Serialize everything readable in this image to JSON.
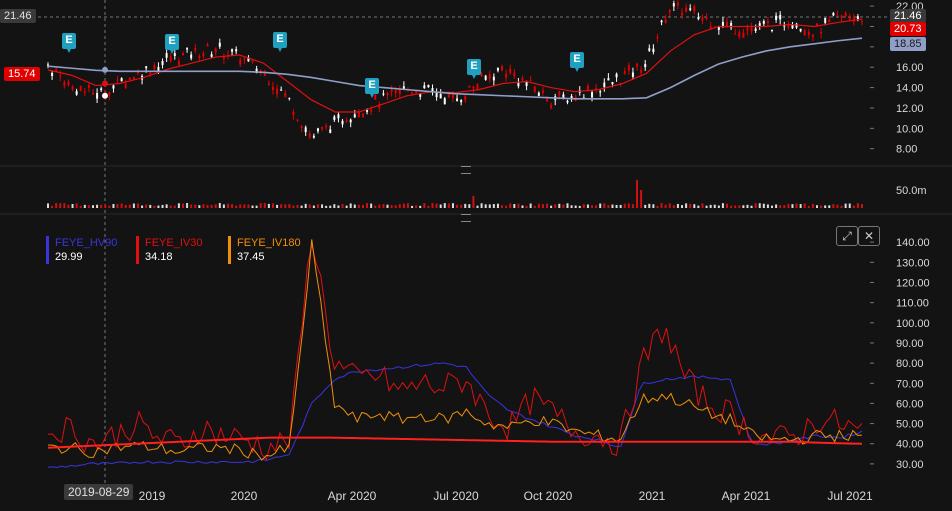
{
  "price_pane": {
    "y_ticks": [
      "8.00",
      "10.00",
      "12.00",
      "14.00",
      "16.00",
      "18.00",
      "20.00",
      "22.00"
    ],
    "y_range": [
      6.4,
      22.6
    ],
    "volume_label": "50.0m",
    "tags": {
      "left_price": "15.74",
      "left_top": "21.46",
      "right_last": "21.46",
      "right_red": "20.73",
      "right_ma": "18.85"
    },
    "earnings_badge_label": "E",
    "colors": {
      "up": "#ffffff",
      "down": "#e00000",
      "ma_fast": "#e01010",
      "ma_slow": "#8f9fc8"
    }
  },
  "indicator_pane": {
    "y_ticks": [
      "30.00",
      "40.00",
      "50.00",
      "60.00",
      "70.00",
      "80.00",
      "90.00",
      "100.00",
      "110.00",
      "120.00",
      "130.00",
      "140.00"
    ],
    "legend": [
      {
        "name": "FEYE_HV90",
        "value": "29.99",
        "color": "#3a34e0"
      },
      {
        "name": "FEYE_IV30",
        "value": "34.18",
        "color": "#e01010"
      },
      {
        "name": "FEYE_IV180",
        "value": "37.45",
        "color": "#f0900a"
      }
    ]
  },
  "x_axis": {
    "ticks": [
      "2019",
      "2020",
      "Apr 2020",
      "Jul 2020",
      "Oct 2020",
      "2021",
      "Apr 2021",
      "Jul 2021"
    ],
    "crosshair_label": "2019-08-29"
  },
  "chart_data": [
    {
      "type": "line",
      "title": "",
      "ylim": [
        6.4,
        22.6
      ],
      "series": [
        {
          "name": "",
          "values": [
            16.2,
            14.0,
            13.4,
            14.4,
            15.6,
            16.8,
            17.3,
            17.8,
            17.0,
            15.4,
            13.0,
            9.0,
            10.6,
            11.8,
            12.8,
            13.8,
            13.6,
            12.8,
            14.4,
            15.8,
            14.4,
            12.8,
            13.2,
            14.0,
            15.0,
            16.5,
            22.0,
            21.2,
            20.2,
            19.6,
            20.0,
            20.6,
            19.4,
            20.8,
            21.0
          ]
        },
        {
          "name": "",
          "values": [
            15.74,
            15.2,
            14.2,
            14.4,
            15.0,
            15.8,
            16.4,
            17.0,
            17.2,
            16.4,
            14.6,
            12.8,
            11.6,
            11.6,
            12.4,
            13.2,
            13.6,
            13.5,
            13.8,
            14.4,
            14.6,
            14.0,
            13.6,
            13.8,
            14.4,
            15.4,
            17.6,
            19.2,
            20.0,
            20.0,
            20.0,
            20.2,
            20.0,
            20.4,
            20.73
          ]
        },
        {
          "name": "",
          "values": [
            16.1,
            15.9,
            15.7,
            15.6,
            15.6,
            15.6,
            15.6,
            15.6,
            15.6,
            15.5,
            15.3,
            15.0,
            14.6,
            14.2,
            14.0,
            13.8,
            13.6,
            13.4,
            13.3,
            13.2,
            13.1,
            13.0,
            12.9,
            12.9,
            12.9,
            13.0,
            14.0,
            15.2,
            16.3,
            17.0,
            17.6,
            18.0,
            18.3,
            18.6,
            18.85
          ]
        }
      ]
    },
    {
      "type": "line",
      "title": "",
      "ylim": [
        23,
        150
      ],
      "series": [
        {
          "name": "FEYE_HV90",
          "values": [
            28,
            29,
            30,
            30,
            31,
            31,
            31,
            31,
            31,
            31,
            32,
            35,
            60,
            72,
            76,
            77,
            78,
            79,
            80,
            78,
            64,
            56,
            52,
            48,
            44,
            42,
            38,
            70,
            72,
            73,
            73,
            72,
            40,
            40,
            42,
            44,
            43,
            46
          ]
        },
        {
          "name": "FEYE_IV30",
          "values": [
            46,
            48,
            40,
            44,
            50,
            43,
            40,
            48,
            44,
            42,
            38,
            42,
            146,
            80,
            72,
            74,
            66,
            70,
            68,
            72,
            55,
            48,
            62,
            55,
            46,
            44,
            40,
            80,
            98,
            72,
            60,
            55,
            46,
            42,
            44,
            52,
            50,
            46
          ]
        },
        {
          "name": "FEYE_IV180",
          "values": [
            38,
            38,
            36,
            38,
            39,
            38,
            36,
            38,
            38,
            36,
            34,
            38,
            140,
            60,
            52,
            55,
            52,
            54,
            52,
            56,
            50,
            48,
            52,
            50,
            46,
            44,
            42,
            62,
            64,
            60,
            55,
            52,
            44,
            42,
            42,
            44,
            44,
            44
          ]
        },
        {
          "name": "",
          "values": [
            38,
            38.5,
            39,
            39.5,
            40,
            40.5,
            41,
            41.5,
            42,
            42.5,
            43,
            43,
            43,
            43,
            42.8,
            42.6,
            42.4,
            42.2,
            42,
            41.8,
            41.6,
            41.4,
            41.2,
            41,
            41,
            41,
            41,
            41,
            41,
            41,
            41,
            41,
            41,
            41,
            41,
            40.5,
            40.2,
            40
          ]
        }
      ],
      "xlabel": "",
      "ylabel": ""
    }
  ]
}
